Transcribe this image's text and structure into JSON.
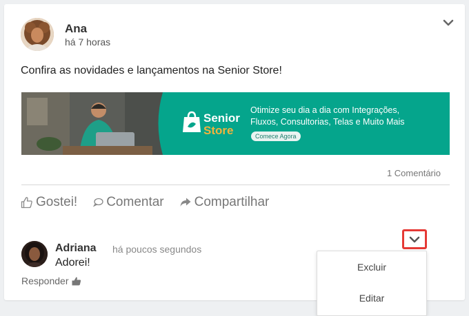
{
  "post": {
    "author": "Ana",
    "time": "há 7 horas",
    "text": "Confira as novidades e lançamentos na Senior Store!",
    "comment_count": "1 Comentário"
  },
  "banner": {
    "brand_line1": "Senior",
    "brand_line2": "Store",
    "headline": "Otimize seu dia a dia com Integrações, Fluxos, Consultorias, Telas e Muito Mais",
    "cta": "Comece Agora"
  },
  "actions": {
    "like": "Gostei!",
    "comment": "Comentar",
    "share": "Compartilhar"
  },
  "comment": {
    "author": "Adriana",
    "time": "há poucos segundos",
    "text": "Adorei!",
    "reply": "Responder"
  },
  "dropdown": {
    "items": [
      "Excluir",
      "Editar"
    ]
  },
  "colors": {
    "banner_teal": "#05a58c",
    "brand_orange": "#f3b33d",
    "highlight_red": "#e53935"
  }
}
